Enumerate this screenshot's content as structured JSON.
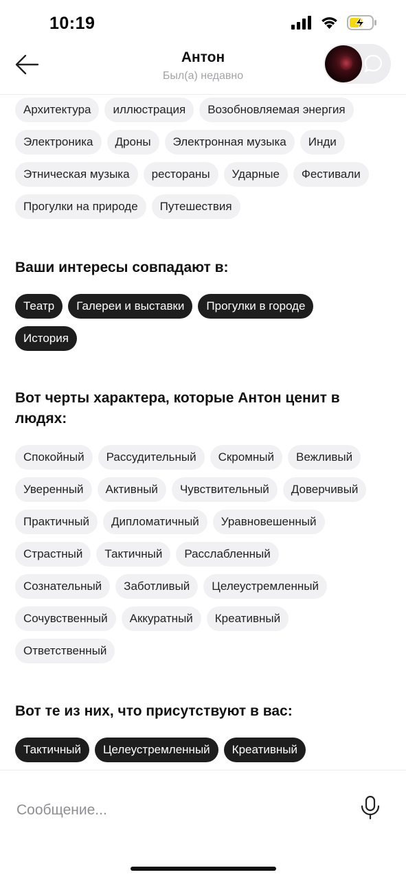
{
  "status": {
    "time": "10:19"
  },
  "header": {
    "name": "Антон",
    "last_seen": "Был(а) недавно"
  },
  "profile": {
    "interests_tags": [
      [
        "Архитектура",
        "иллюстрация",
        "Возобновляемая энергия"
      ],
      [
        "Электроника",
        "Дроны",
        "Электронная музыка",
        "Инди"
      ],
      [
        "Этническая музыка",
        "рестораны",
        "Ударные",
        "Фестивали"
      ],
      [
        "Прогулки на природе",
        "Путешествия"
      ]
    ],
    "shared_interests_title": "Ваши интересы совпадают в:",
    "shared_interests": [
      "Театр",
      "Галереи и выставки",
      "Прогулки в городе",
      "История"
    ],
    "valued_traits_title": "Вот черты характера, которые Антон ценит в людях:",
    "valued_traits": [
      "Спокойный",
      "Рассудительный",
      "Скромный",
      "Вежливый",
      "Уверенный",
      "Активный",
      "Чувствительный",
      "Доверчивый",
      "Практичный",
      "Дипломатичный",
      "Уравновешенный",
      "Страстный",
      "Тактичный",
      "Расслабленный",
      "Сознательный",
      "Заботливый",
      "Целеустремленный",
      "Сочувственный",
      "Аккуратный",
      "Креативный",
      "Ответственный"
    ],
    "matching_traits_title": "Вот те из них, что присутствуют в вас:",
    "matching_traits": [
      "Тактичный",
      "Целеустремленный",
      "Креативный"
    ]
  },
  "composer": {
    "placeholder": "Сообщение..."
  },
  "colors": {
    "dark_tag": "#1e1e1e",
    "light_tag": "#f1f1f3",
    "battery_accent": "#f5d90a"
  },
  "icons": [
    "signal-icon",
    "wifi-icon",
    "battery-charging-icon",
    "back-arrow-icon",
    "chat-bubble-icon",
    "microphone-icon"
  ]
}
